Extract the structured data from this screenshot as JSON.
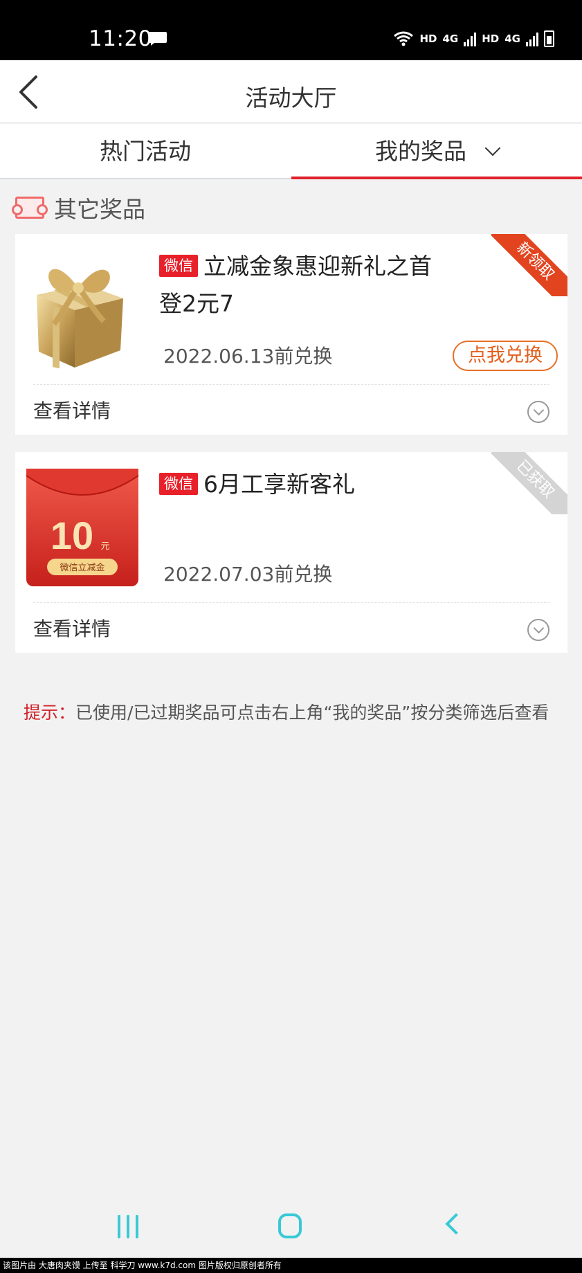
{
  "status_bar": {
    "time": "11:20",
    "indicators": [
      "HD",
      "4G",
      "HD",
      "4G"
    ]
  },
  "nav": {
    "title": "活动大厅",
    "back_icon": "chevron-left-icon"
  },
  "tabs": [
    {
      "label": "热门活动",
      "active": false
    },
    {
      "label": "我的奖品",
      "active": true
    }
  ],
  "section": {
    "title": "其它奖品",
    "icon": "ticket-icon"
  },
  "prizes": [
    {
      "source": "微信",
      "title": "立减金象惠迎新礼之首登2元7",
      "expiry": "2022.06.13前兑换",
      "ribbon": "新领取",
      "action": "点我兑换",
      "detail": "查看详情",
      "image": "gift-box"
    },
    {
      "source": "微信",
      "title": "6月工享新客礼",
      "expiry": "2022.07.03前兑换",
      "ribbon": "已获取",
      "detail": "查看详情",
      "image": "red-envelope",
      "envelope_amount": "10",
      "envelope_unit": "元",
      "envelope_label": "微信立减金"
    }
  ],
  "tip": {
    "label": "提示：",
    "text": "已使用/已过期奖品可点击右上角“我的奖品”按分类筛选后查看"
  },
  "footer": "该图片由 大唐肉夹馍 上传至 科学刀 www.k7d.com 图片版权归原创者所有",
  "colors": {
    "accent": "#e0212b",
    "redeem": "#e35e1b",
    "nav_button": "#39c9d6"
  }
}
